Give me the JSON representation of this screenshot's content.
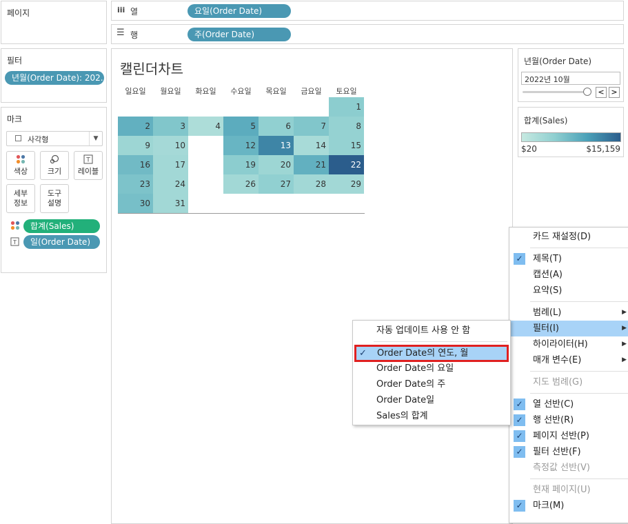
{
  "left": {
    "pages_title": "페이지",
    "filters_title": "필터",
    "filter_pill": "년월(Order Date): 202..",
    "marks_title": "마크",
    "mark_type": "사각형",
    "mark_buttons": [
      {
        "label": "색상",
        "icon": "color-dots"
      },
      {
        "label": "크기",
        "icon": "size-circle"
      },
      {
        "label": "레이블",
        "icon": "label-T"
      },
      {
        "label": "세부\n정보",
        "icon": "detail"
      },
      {
        "label": "도구\n설명",
        "icon": "tooltip"
      }
    ],
    "mark_pills": [
      {
        "label": "합계(Sales)",
        "kind": "color"
      },
      {
        "label": "일(Order Date)",
        "kind": "label"
      }
    ]
  },
  "shelves": {
    "columns_label": "열",
    "columns_pill": "요일(Order Date)",
    "rows_label": "행",
    "rows_pill": "주(Order Date)"
  },
  "view": {
    "title": "캘린더차트",
    "weekdays": [
      "일요일",
      "월요일",
      "화요일",
      "수요일",
      "목요일",
      "금요일",
      "토요일"
    ]
  },
  "chart_data": {
    "type": "heatmap",
    "title": "캘린더차트",
    "month": "2022년 10월",
    "color_legend_title": "합계(Sales)",
    "color_range": [
      "$20",
      "$15,159"
    ],
    "colors": [
      "#c6e9e1",
      "#2b5d8c"
    ],
    "cells": [
      {
        "day": 1,
        "row": 0,
        "col": 6,
        "v": 0.35
      },
      {
        "day": 2,
        "row": 1,
        "col": 0,
        "v": 0.55
      },
      {
        "day": 3,
        "row": 1,
        "col": 1,
        "v": 0.4
      },
      {
        "day": 4,
        "row": 1,
        "col": 2,
        "v": 0.15
      },
      {
        "day": 5,
        "row": 1,
        "col": 3,
        "v": 0.58
      },
      {
        "day": 6,
        "row": 1,
        "col": 4,
        "v": 0.32
      },
      {
        "day": 7,
        "row": 1,
        "col": 5,
        "v": 0.4
      },
      {
        "day": 8,
        "row": 1,
        "col": 6,
        "v": 0.3
      },
      {
        "day": 9,
        "row": 2,
        "col": 0,
        "v": 0.25
      },
      {
        "day": 10,
        "row": 2,
        "col": 1,
        "v": 0.2
      },
      {
        "day": 12,
        "row": 2,
        "col": 3,
        "v": 0.52
      },
      {
        "day": 13,
        "row": 2,
        "col": 4,
        "v": 0.8
      },
      {
        "day": 14,
        "row": 2,
        "col": 5,
        "v": 0.18
      },
      {
        "day": 15,
        "row": 2,
        "col": 6,
        "v": 0.3
      },
      {
        "day": 16,
        "row": 3,
        "col": 0,
        "v": 0.48
      },
      {
        "day": 17,
        "row": 3,
        "col": 1,
        "v": 0.22
      },
      {
        "day": 19,
        "row": 3,
        "col": 3,
        "v": 0.35
      },
      {
        "day": 20,
        "row": 3,
        "col": 4,
        "v": 0.25
      },
      {
        "day": 21,
        "row": 3,
        "col": 5,
        "v": 0.55
      },
      {
        "day": 22,
        "row": 3,
        "col": 6,
        "v": 1.0
      },
      {
        "day": 23,
        "row": 4,
        "col": 0,
        "v": 0.42
      },
      {
        "day": 24,
        "row": 4,
        "col": 1,
        "v": 0.22
      },
      {
        "day": 26,
        "row": 4,
        "col": 3,
        "v": 0.22
      },
      {
        "day": 27,
        "row": 4,
        "col": 4,
        "v": 0.32
      },
      {
        "day": 28,
        "row": 4,
        "col": 5,
        "v": 0.22
      },
      {
        "day": 29,
        "row": 4,
        "col": 6,
        "v": 0.22
      },
      {
        "day": 30,
        "row": 5,
        "col": 0,
        "v": 0.45
      },
      {
        "day": 31,
        "row": 5,
        "col": 1,
        "v": 0.22
      }
    ]
  },
  "right": {
    "filter_card_title": "년월(Order Date)",
    "filter_value": "2022년 10월",
    "prev_symbol": "<",
    "next_symbol": ">",
    "legend_title": "합계(Sales)",
    "legend_min": "$20",
    "legend_max": "$15,159"
  },
  "context_menu": {
    "items": [
      {
        "label": "카드 재설정(D)",
        "checked": false,
        "submenu": false,
        "disabled": false
      },
      {
        "label": "제목(T)",
        "checked": true,
        "submenu": false,
        "disabled": false
      },
      {
        "label": "캡션(A)",
        "checked": false,
        "submenu": false,
        "disabled": false
      },
      {
        "label": "요약(S)",
        "checked": false,
        "submenu": false,
        "disabled": false
      },
      {
        "label": "범례(L)",
        "checked": false,
        "submenu": true,
        "disabled": false
      },
      {
        "label": "필터(I)",
        "checked": false,
        "submenu": true,
        "disabled": false,
        "highlight": true
      },
      {
        "label": "하이라이터(H)",
        "checked": false,
        "submenu": true,
        "disabled": false
      },
      {
        "label": "매개 변수(E)",
        "checked": false,
        "submenu": true,
        "disabled": false
      },
      {
        "label": "지도 범례(G)",
        "checked": false,
        "submenu": false,
        "disabled": true
      },
      {
        "label": "열 선반(C)",
        "checked": true,
        "submenu": false,
        "disabled": false
      },
      {
        "label": "행 선반(R)",
        "checked": true,
        "submenu": false,
        "disabled": false
      },
      {
        "label": "페이지 선반(P)",
        "checked": true,
        "submenu": false,
        "disabled": false
      },
      {
        "label": "필터 선반(F)",
        "checked": true,
        "submenu": false,
        "disabled": false
      },
      {
        "label": "측정값 선반(V)",
        "checked": false,
        "submenu": false,
        "disabled": true
      },
      {
        "label": "현재 페이지(U)",
        "checked": false,
        "submenu": false,
        "disabled": true
      },
      {
        "label": "마크(M)",
        "checked": true,
        "submenu": false,
        "disabled": false
      }
    ]
  },
  "submenu": {
    "items": [
      {
        "label": "자동 업데이트 사용 안 함",
        "checked": false
      },
      {
        "label": "Order Date의 연도, 월",
        "checked": true,
        "selected": true
      },
      {
        "label": "Order Date의 요일",
        "checked": false
      },
      {
        "label": "Order Date의 주",
        "checked": false
      },
      {
        "label": "Order Date일",
        "checked": false
      },
      {
        "label": "Sales의 합계",
        "checked": false
      }
    ]
  }
}
